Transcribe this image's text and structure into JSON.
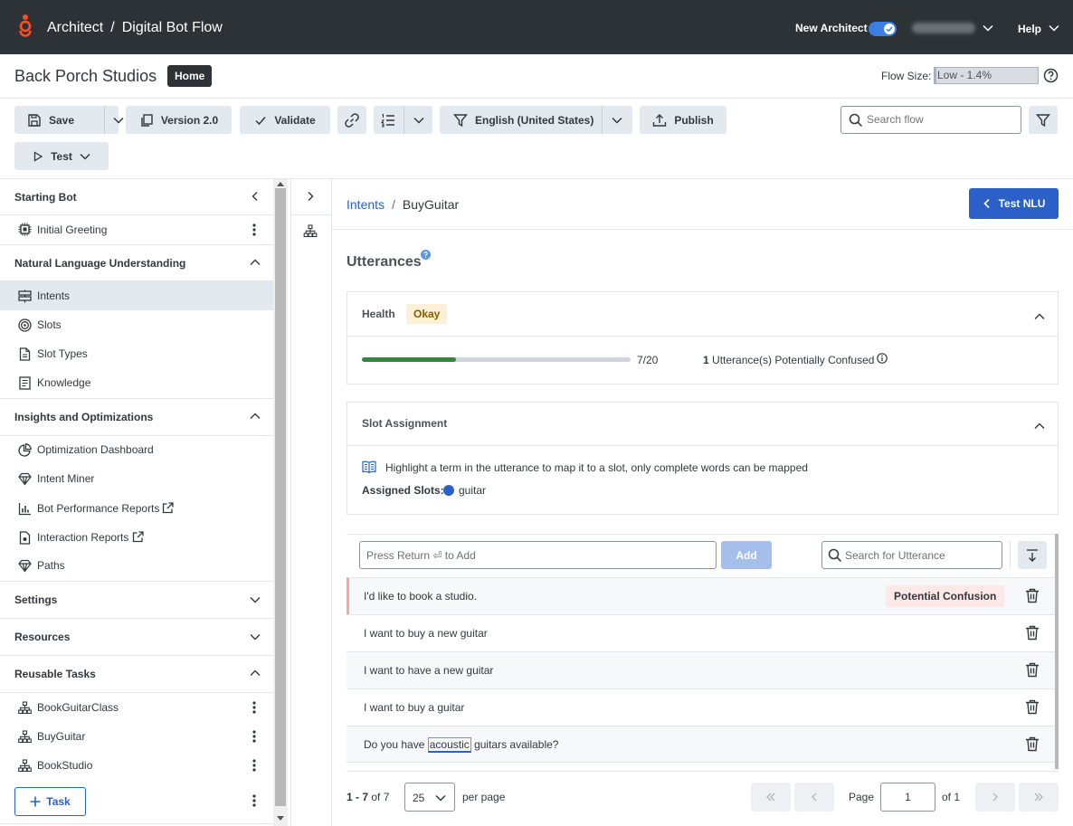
{
  "topbar": {
    "app": "Architect",
    "separator": "/",
    "flow": "Digital Bot Flow",
    "new_architect_label": "New Architect",
    "help_label": "Help"
  },
  "header": {
    "org": "Back Porch Studios",
    "home_badge": "Home",
    "flow_size_label": "Flow Size:",
    "flow_size_value": "Low - 1.4%",
    "flow_size_fraction": 0.014
  },
  "toolbar": {
    "save": "Save",
    "version": "Version 2.0",
    "validate": "Validate",
    "language": "English (United States)",
    "publish": "Publish",
    "test": "Test",
    "search_placeholder": "Search flow"
  },
  "sidebar": {
    "starting_bot": {
      "title": "Starting Bot",
      "items": [
        "Initial Greeting"
      ]
    },
    "nlu": {
      "title": "Natural Language Understanding",
      "items": [
        "Intents",
        "Slots",
        "Slot Types",
        "Knowledge"
      ]
    },
    "insights": {
      "title": "Insights and Optimizations",
      "items": [
        "Optimization Dashboard",
        "Intent Miner",
        "Bot Performance Reports",
        "Interaction Reports",
        "Paths"
      ]
    },
    "settings": {
      "title": "Settings"
    },
    "resources": {
      "title": "Resources"
    },
    "reusable_tasks": {
      "title": "Reusable Tasks",
      "items": [
        "BookGuitarClass",
        "BuyGuitar",
        "BookStudio"
      ]
    },
    "add_task": "Task"
  },
  "main": {
    "breadcrumb": {
      "parent": "Intents",
      "separator": "/",
      "current": "BuyGuitar"
    },
    "test_nlu": "Test NLU",
    "section_title": "Utterances",
    "health": {
      "title": "Health",
      "status": "Okay",
      "progress_count": "7/20",
      "progress_fraction": 0.35,
      "confused_count": "1",
      "confused_label": "Utterance(s) Potentially Confused"
    },
    "slot_assignment": {
      "title": "Slot Assignment",
      "hint": "Highlight a term in the utterance to map it to a slot, only complete words can be mapped",
      "assigned_label": "Assigned Slots:",
      "slot_name": "guitar",
      "slot_color": "#2a60c8"
    },
    "utterance_input_placeholder": "Press Return ⏎ to Add",
    "add_button": "Add",
    "search_utterance_placeholder": "Search for Utterance",
    "utterances": [
      {
        "text": "I'd like to book a studio.",
        "badge": "Potential Confusion"
      },
      {
        "text": "I want to buy a new guitar"
      },
      {
        "text": "I want to have a new guitar"
      },
      {
        "text": "I want to buy a guitar"
      },
      {
        "before": "Do you have ",
        "highlight": "acoustic",
        "after": " guitars available?"
      }
    ],
    "pagination": {
      "range": "1 - 7",
      "of_total": "of 7",
      "per_page_value": "25",
      "per_page_label": "per page",
      "page_label": "Page",
      "page_value": "1",
      "of_pages": "of 1"
    }
  },
  "colors": {
    "accent": "#2a60c8",
    "topbar": "#2d3237",
    "logo": "#ff4f1f",
    "health_ok": "#2f8a3e",
    "confusion_border": "#f2a6a6"
  }
}
